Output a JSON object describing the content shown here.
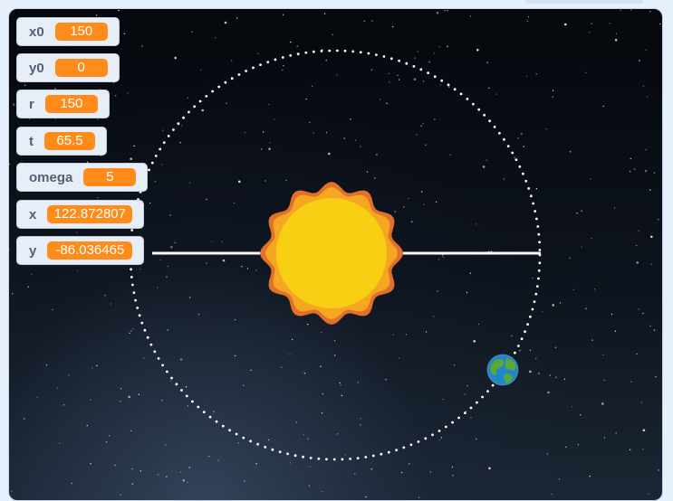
{
  "stage": {
    "monitors": [
      {
        "label": "x0",
        "value": "150"
      },
      {
        "label": "y0",
        "value": "0"
      },
      {
        "label": "r",
        "value": "150"
      },
      {
        "label": "t",
        "value": "65.5"
      },
      {
        "label": "omega",
        "value": "5"
      },
      {
        "label": "x",
        "value": "122.872807"
      },
      {
        "label": "y",
        "value": "-86.036465"
      }
    ],
    "sprites": {
      "sun": "sun-sprite",
      "earth": "earth-sprite"
    },
    "colors": {
      "monitor_value_bg": "#ff8c1a",
      "monitor_bg": "#e8eef7",
      "monitor_label": "#575e75",
      "orbit_dots": "#ffffff",
      "sun_outer": "#e0702a",
      "sun_mid": "#f5a623",
      "sun_inner": "#f9cf14"
    }
  }
}
